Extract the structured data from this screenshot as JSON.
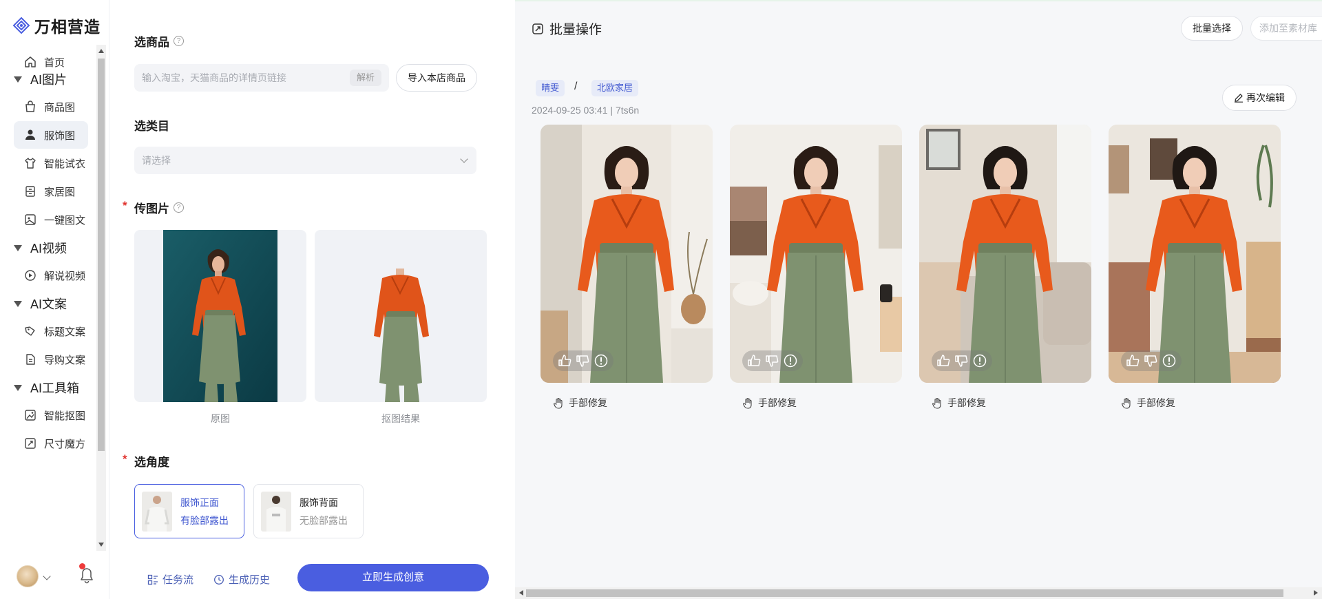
{
  "app": {
    "logo_text": "万相营造"
  },
  "sidebar": {
    "items": [
      {
        "label": "首页",
        "icon": "home-icon"
      },
      {
        "group": "AI图片"
      },
      {
        "label": "商品图",
        "icon": "bag-icon"
      },
      {
        "label": "服饰图",
        "icon": "person-icon",
        "active": true
      },
      {
        "label": "智能试衣",
        "icon": "shirt-icon"
      },
      {
        "label": "家居图",
        "icon": "cabinet-icon"
      },
      {
        "label": "一键图文",
        "icon": "image-icon"
      },
      {
        "group": "AI视频"
      },
      {
        "label": "解说视频",
        "icon": "play-icon"
      },
      {
        "group": "AI文案"
      },
      {
        "label": "标题文案",
        "icon": "tag-icon"
      },
      {
        "label": "导购文案",
        "icon": "document-icon"
      },
      {
        "group": "AI工具箱"
      },
      {
        "label": "智能抠图",
        "icon": "cutout-icon"
      },
      {
        "label": "尺寸魔方",
        "icon": "resize-icon"
      }
    ]
  },
  "form": {
    "product": {
      "title": "选商品",
      "input_placeholder": "输入淘宝，天猫商品的详情页链接",
      "parse_label": "解析",
      "import_label": "导入本店商品"
    },
    "category": {
      "title": "选类目",
      "placeholder": "请选择"
    },
    "upload": {
      "title": "传图片",
      "original_caption": "原图",
      "cutout_caption": "抠图结果"
    },
    "angle": {
      "title": "选角度",
      "options": [
        {
          "line1": "服饰正面",
          "line2": "有脸部露出",
          "selected": true
        },
        {
          "line1": "服饰背面",
          "line2": "无脸部露出",
          "selected": false
        }
      ]
    },
    "footer": {
      "task_flow": "任务流",
      "history": "生成历史",
      "generate": "立即生成创意"
    }
  },
  "result": {
    "title": "批量操作",
    "batch_select": "批量选择",
    "add_to_library": "添加至素材库",
    "tags": [
      "晴雯",
      "北欧家居"
    ],
    "tag_separator": "/",
    "meta": "2024-09-25 03:41 | 7ts6n",
    "reedit": "再次编辑",
    "cards": [
      {
        "repair_label": "手部修复"
      },
      {
        "repair_label": "手部修复"
      },
      {
        "repair_label": "手部修复"
      },
      {
        "repair_label": "手部修复"
      }
    ]
  },
  "colors": {
    "accent": "#4a5ee0",
    "tag_bg": "#e7ebf8",
    "shirt": "#e85a1c",
    "skirt": "#7f9270"
  }
}
